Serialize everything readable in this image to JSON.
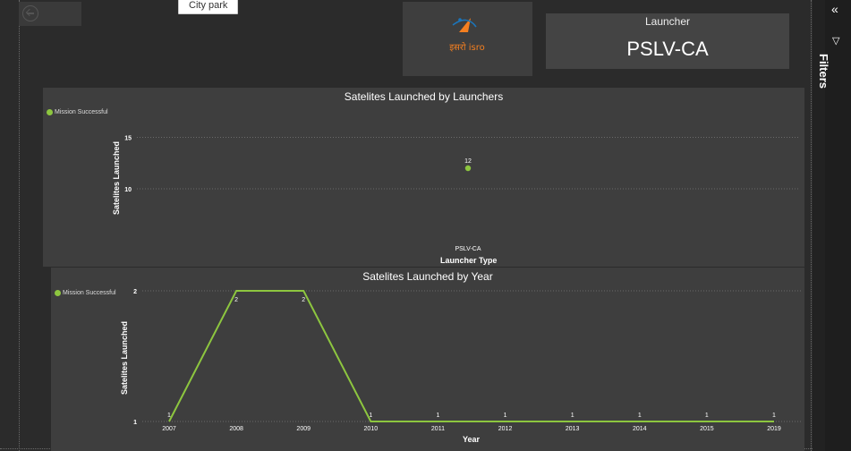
{
  "tooltip": {
    "text": "City park"
  },
  "launcher_card": {
    "label": "Launcher",
    "value": "PSLV-CA"
  },
  "logo": {
    "text": "इसरो isro"
  },
  "filters": {
    "label": "Filters"
  },
  "colors": {
    "series": "#8dc63f",
    "background": "#2b2b2b",
    "panel": "#3e3e3e"
  },
  "icons": {
    "back": "back-arrow-icon",
    "filters_collapse": "chevron-left-icon",
    "filter": "funnel-icon"
  },
  "chart_data": [
    {
      "type": "scatter",
      "title": "Satelites Launched by Launchers",
      "xlabel": "Launcher Type",
      "ylabel": "Satelites Launched",
      "legend": "top-left",
      "series": [
        {
          "name": "Mission Successful",
          "x": [
            "PSLV-CA"
          ],
          "values": [
            12
          ]
        }
      ],
      "categories": [
        "PSLV-CA"
      ],
      "yticks": [
        10,
        15
      ],
      "ylim": [
        8,
        16
      ],
      "grid": true
    },
    {
      "type": "line",
      "title": "Satelites Launched by Year",
      "xlabel": "Year",
      "ylabel": "Satelites Launched",
      "legend": "top-left",
      "categories": [
        "2007",
        "2008",
        "2009",
        "2010",
        "2011",
        "2012",
        "2013",
        "2014",
        "2015",
        "2019"
      ],
      "series": [
        {
          "name": "Mission Successful",
          "values": [
            1,
            2,
            2,
            1,
            1,
            1,
            1,
            1,
            1,
            1
          ]
        }
      ],
      "yticks": [
        1,
        2
      ],
      "ylim": [
        1,
        2
      ],
      "grid": true
    }
  ]
}
